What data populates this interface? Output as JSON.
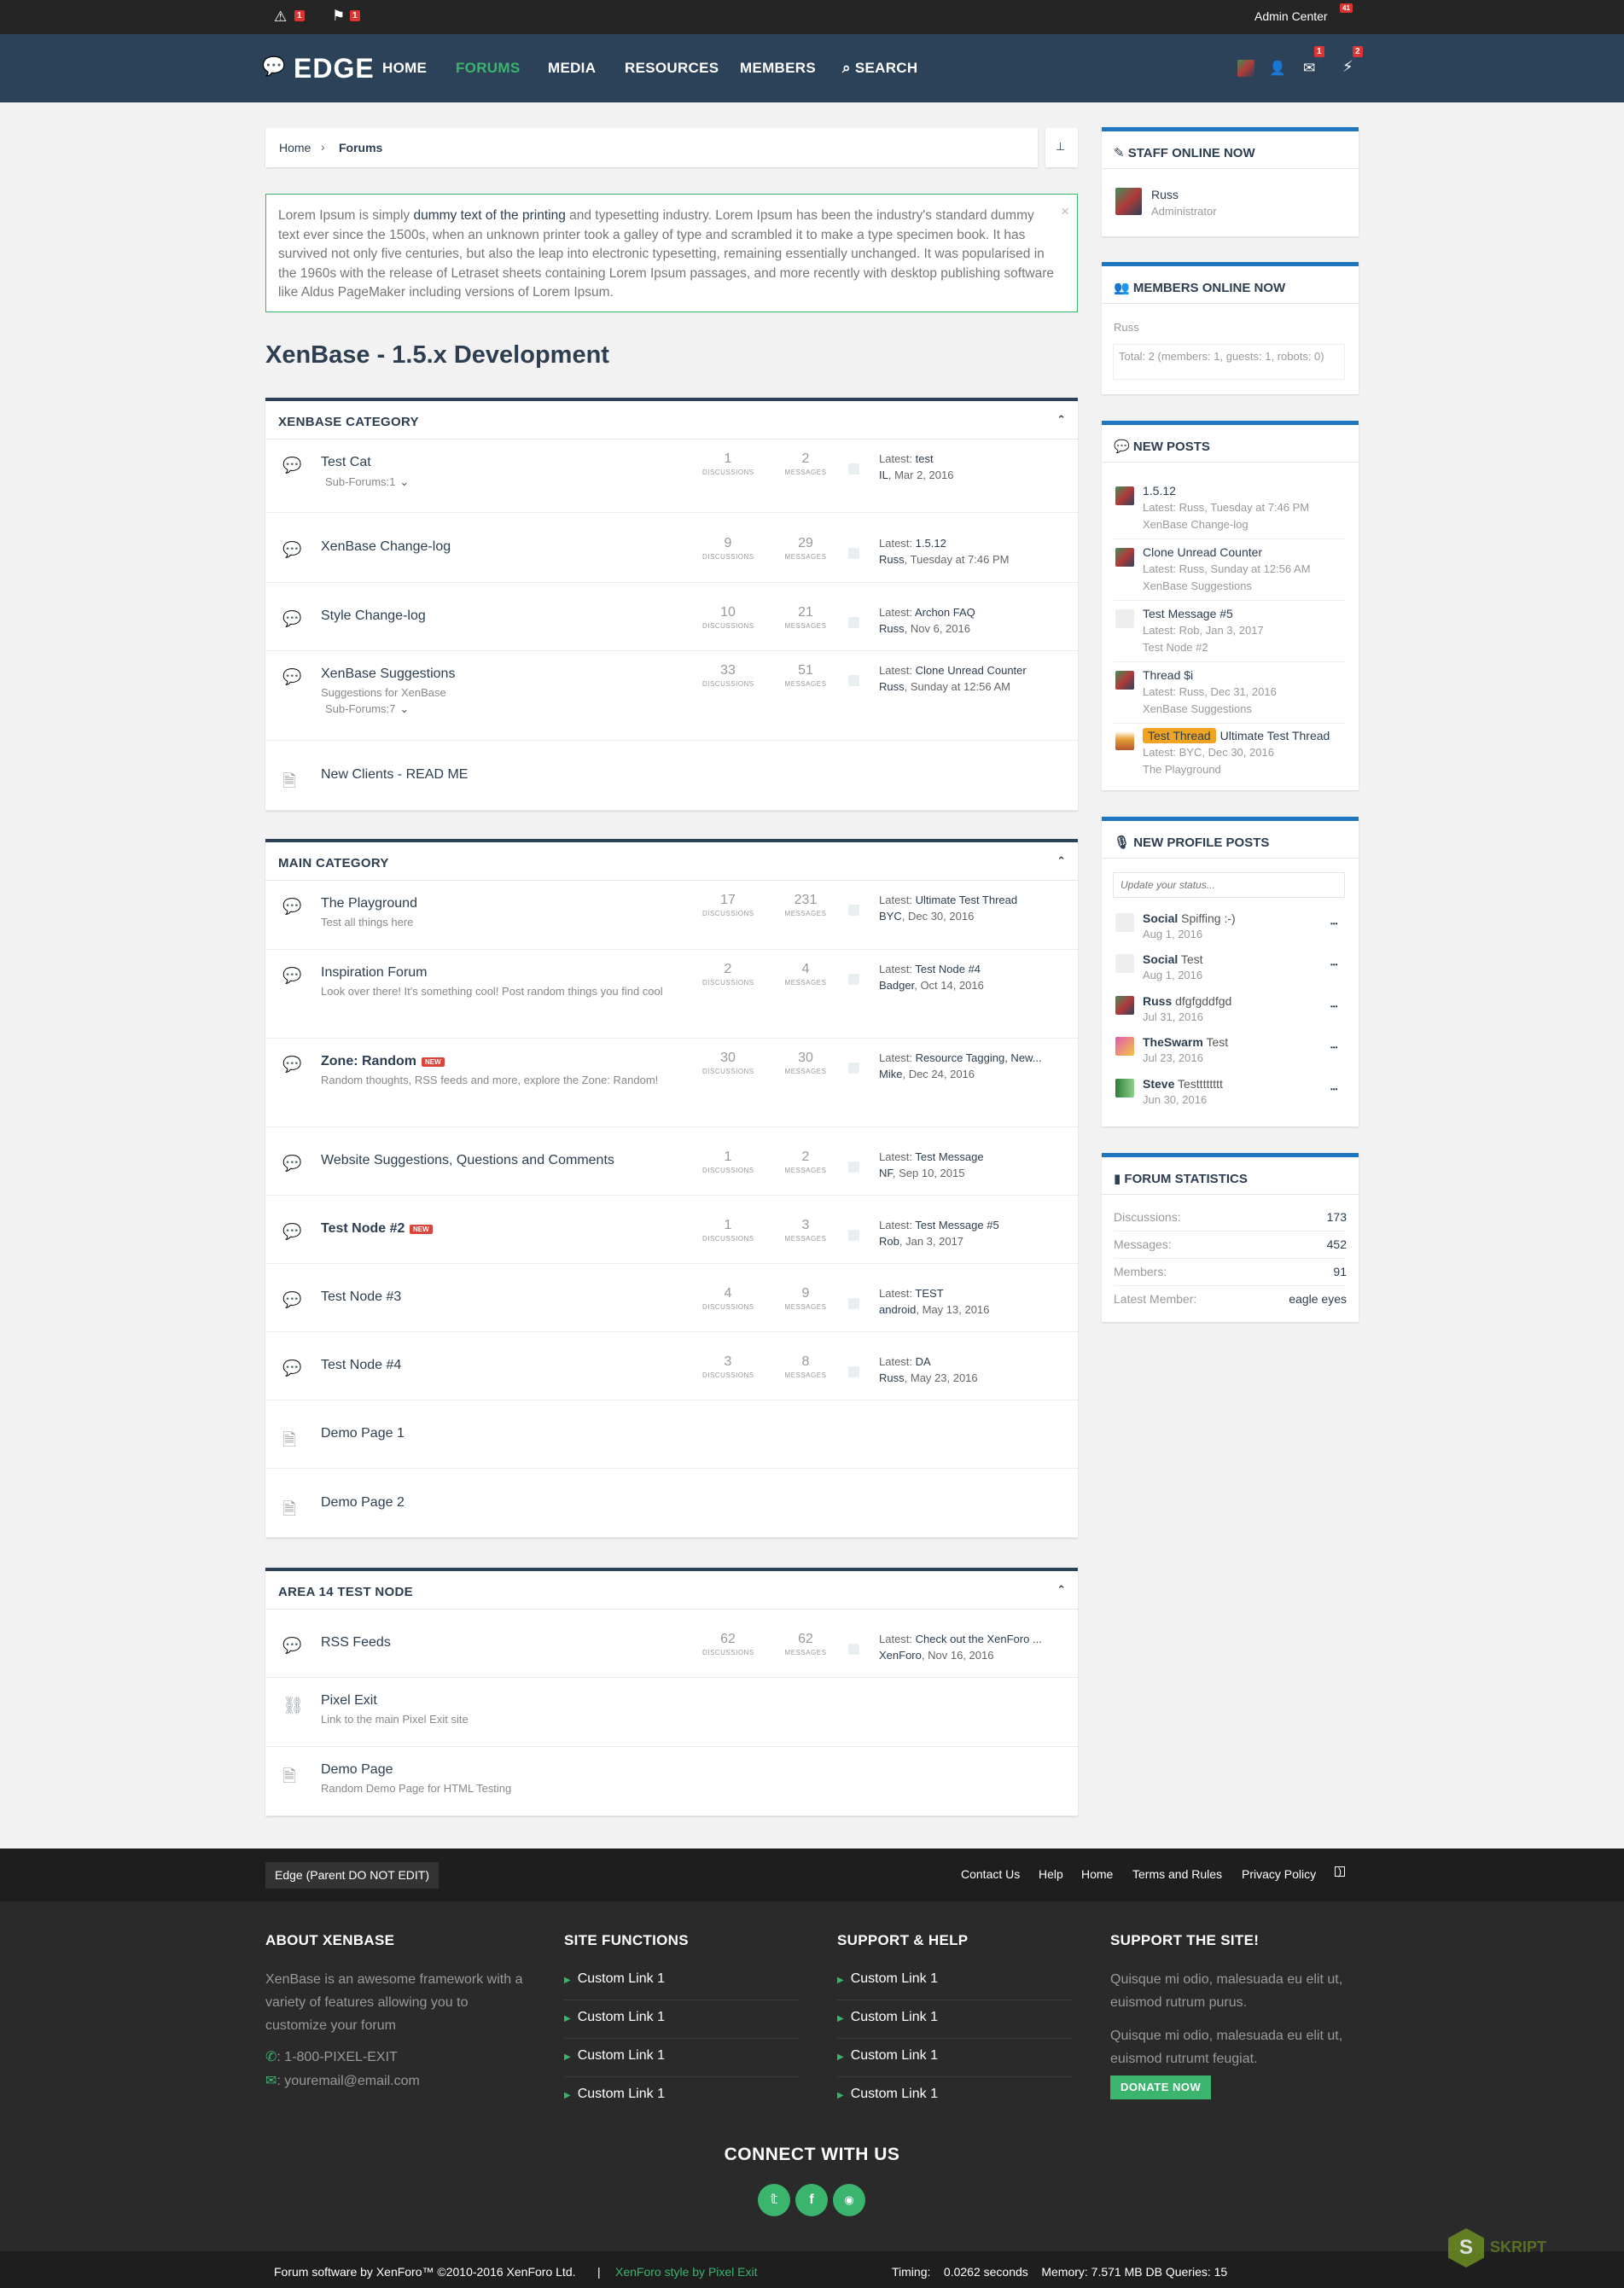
{
  "topbar": {
    "alerts_badge": "1",
    "flag_badge": "1",
    "admin_center": "Admin Center",
    "admin_badge": "41"
  },
  "nav": {
    "logo": "EDGE",
    "links": [
      "HOME",
      "FORUMS",
      "MEDIA",
      "RESOURCES",
      "MEMBERS",
      "SEARCH"
    ],
    "inbox_badge": "1",
    "alerts_badge": "2"
  },
  "breadcrumb": {
    "home": "Home",
    "sep": "›",
    "current": "Forums"
  },
  "notice": {
    "pre": "Lorem Ipsum is simply ",
    "bold": "dummy text of the printing",
    "post": " and typesetting industry. Lorem Ipsum has been the industry's standard dummy text ever since the 1500s, when an unknown printer took a galley of type and scrambled it to make a type specimen book. It has survived not only five centuries, but also the leap into electronic typesetting, remaining essentially unchanged. It was popularised in the 1960s with the release of Letraset sheets containing Lorem Ipsum passages, and more recently with desktop publishing software like Aldus PageMaker including versions of Lorem Ipsum.",
    "close": "×"
  },
  "page_title": "XenBase - 1.5.x Development",
  "labels": {
    "discussions": "DISCUSSIONS",
    "messages": "MESSAGES",
    "latest": "Latest:",
    "subforums": "Sub-Forums:",
    "new": "NEW"
  },
  "categories": [
    {
      "title": "XENBASE CATEGORY",
      "forums": [
        {
          "name": "Test Cat",
          "sub": "1",
          "d": "1",
          "m": "2",
          "lt": "test",
          "lu": "IL",
          "ld": "Mar 2, 2016"
        },
        {
          "name": "XenBase Change-log",
          "d": "9",
          "m": "29",
          "lt": "1.5.12",
          "lu": "Russ",
          "ld": "Tuesday at 7:46 PM"
        },
        {
          "name": "Style Change-log",
          "d": "10",
          "m": "21",
          "lt": "Archon FAQ",
          "lu": "Russ",
          "ld": "Nov 6, 2016"
        },
        {
          "name": "XenBase Suggestions",
          "desc": "Suggestions for XenBase",
          "sub": "7",
          "d": "33",
          "m": "51",
          "lt": "Clone Unread Counter",
          "lu": "Russ",
          "ld": "Sunday at 12:56 AM"
        },
        {
          "name": "New Clients - READ ME"
        }
      ]
    },
    {
      "title": "MAIN CATEGORY",
      "forums": [
        {
          "name": "The Playground",
          "desc": "Test all things here",
          "d": "17",
          "m": "231",
          "lt": "Ultimate Test Thread",
          "lu": "BYC",
          "ld": "Dec 30, 2016"
        },
        {
          "name": "Inspiration Forum",
          "desc": "Look over there! It's something cool! Post random things you find cool",
          "d": "2",
          "m": "4",
          "lt": "Test Node #4",
          "lu": "Badger",
          "ld": "Oct 14, 2016"
        },
        {
          "name": "Zone: Random",
          "desc": "Random thoughts, RSS feeds and more, explore the Zone: Random!",
          "d": "30",
          "m": "30",
          "lt": "Resource Tagging, New...",
          "lu": "Mike",
          "ld": "Dec 24, 2016"
        },
        {
          "name": "Website Suggestions, Questions and Comments",
          "d": "1",
          "m": "2",
          "lt": "Test Message",
          "lu": "NF",
          "ld": "Sep 10, 2015"
        },
        {
          "name": "Test Node #2",
          "d": "1",
          "m": "3",
          "lt": "Test Message #5",
          "lu": "Rob",
          "ld": "Jan 3, 2017"
        },
        {
          "name": "Test Node #3",
          "d": "4",
          "m": "9",
          "lt": "TEST",
          "lu": "android",
          "ld": "May 13, 2016"
        },
        {
          "name": "Test Node #4",
          "d": "3",
          "m": "8",
          "lt": "DA",
          "lu": "Russ",
          "ld": "May 23, 2016"
        },
        {
          "name": "Demo Page 1"
        },
        {
          "name": "Demo Page 2"
        }
      ]
    },
    {
      "title": "AREA 14 TEST NODE",
      "forums": [
        {
          "name": "RSS Feeds",
          "d": "62",
          "m": "62",
          "lt": "Check out the XenForo ...",
          "lu": "XenForo",
          "ld": "Nov 16, 2016"
        },
        {
          "name": "Pixel Exit",
          "desc": "Link to the main Pixel Exit site"
        },
        {
          "name": "Demo Page",
          "desc": "Random Demo Page for HTML Testing"
        }
      ]
    }
  ],
  "sidebar": {
    "staff": {
      "title": "STAFF ONLINE NOW",
      "name": "Russ",
      "role": "Administrator"
    },
    "members": {
      "title": "MEMBERS ONLINE NOW",
      "name": "Russ",
      "total": "Total: 2 (members: 1, guests: 1, robots: 0)"
    },
    "new_posts": {
      "title": "NEW POSTS",
      "items": [
        {
          "title": "1.5.12",
          "meta": "Latest: Russ, Tuesday at 7:46 PM",
          "forum": "XenBase Change-log"
        },
        {
          "title": "Clone Unread Counter",
          "meta": "Latest: Russ, Sunday at 12:56 AM",
          "forum": "XenBase Suggestions"
        },
        {
          "title": "Test Message #5",
          "meta": "Latest: Rob, Jan 3, 2017",
          "forum": "Test Node #2"
        },
        {
          "title": "Thread $i",
          "meta": "Latest: Russ, Dec 31, 2016",
          "forum": "XenBase Suggestions"
        },
        {
          "prefix": "Test Thread",
          "title": "Ultimate Test Thread",
          "meta": "Latest: BYC, Dec 30, 2016",
          "forum": "The Playground"
        }
      ]
    },
    "profile_posts": {
      "title": "NEW PROFILE POSTS",
      "placeholder": "Update your status...",
      "items": [
        {
          "user": "Social",
          "text": "Spiffing :-)",
          "date": "Aug 1, 2016"
        },
        {
          "user": "Social",
          "text": "Test",
          "date": "Aug 1, 2016"
        },
        {
          "user": "Russ",
          "text": "dfgfgddfgd",
          "date": "Jul 31, 2016"
        },
        {
          "user": "TheSwarm",
          "text": "Test",
          "date": "Jul 23, 2016"
        },
        {
          "user": "Steve",
          "text": "Testttttttt",
          "date": "Jun 30, 2016"
        }
      ]
    },
    "stats": {
      "title": "FORUM STATISTICS",
      "rows": [
        {
          "k": "Discussions:",
          "v": "173"
        },
        {
          "k": "Messages:",
          "v": "452"
        },
        {
          "k": "Members:",
          "v": "91"
        },
        {
          "k": "Latest Member:",
          "v": "eagle eyes"
        }
      ]
    }
  },
  "footer": {
    "style_chooser": "Edge (Parent DO NOT EDIT)",
    "links": [
      "Contact Us",
      "Help",
      "Home",
      "Terms and Rules",
      "Privacy Policy"
    ],
    "about": {
      "title": "ABOUT XENBASE",
      "text": "XenBase is an awesome framework with a variety of features allowing you to customize your forum",
      "phone": ": 1-800-PIXEL-EXIT",
      "email": ": youremail@email.com"
    },
    "site_functions": {
      "title": "SITE FUNCTIONS",
      "links": [
        "Custom Link 1",
        "Custom Link 1",
        "Custom Link 1",
        "Custom Link 1"
      ]
    },
    "support": {
      "title": "SUPPORT & HELP",
      "links": [
        "Custom Link 1",
        "Custom Link 1",
        "Custom Link 1",
        "Custom Link 1"
      ]
    },
    "donate": {
      "title": "SUPPORT THE SITE!",
      "p1": "Quisque mi odio, malesuada eu elit ut, euismod rutrum purus.",
      "p2": "Quisque mi odio, malesuada eu elit ut, euismod rutrumt feugiat.",
      "button": "DONATE NOW"
    },
    "connect": "CONNECT WITH US",
    "copyright": "Forum software by XenForo™ ©2010-2016 XenForo Ltd.",
    "sep": "|",
    "style_by": "XenForo style by Pixel Exit",
    "timing": "Timing:    0.0262 seconds    Memory: 7.571 MB DB Queries: 15",
    "watermark": "SKRIPT"
  },
  "colors": {
    "nav_bg": "#2c4258",
    "accent_green": "#3bb46e",
    "side_accent": "#1e75c0",
    "badge_red": "#d33"
  }
}
